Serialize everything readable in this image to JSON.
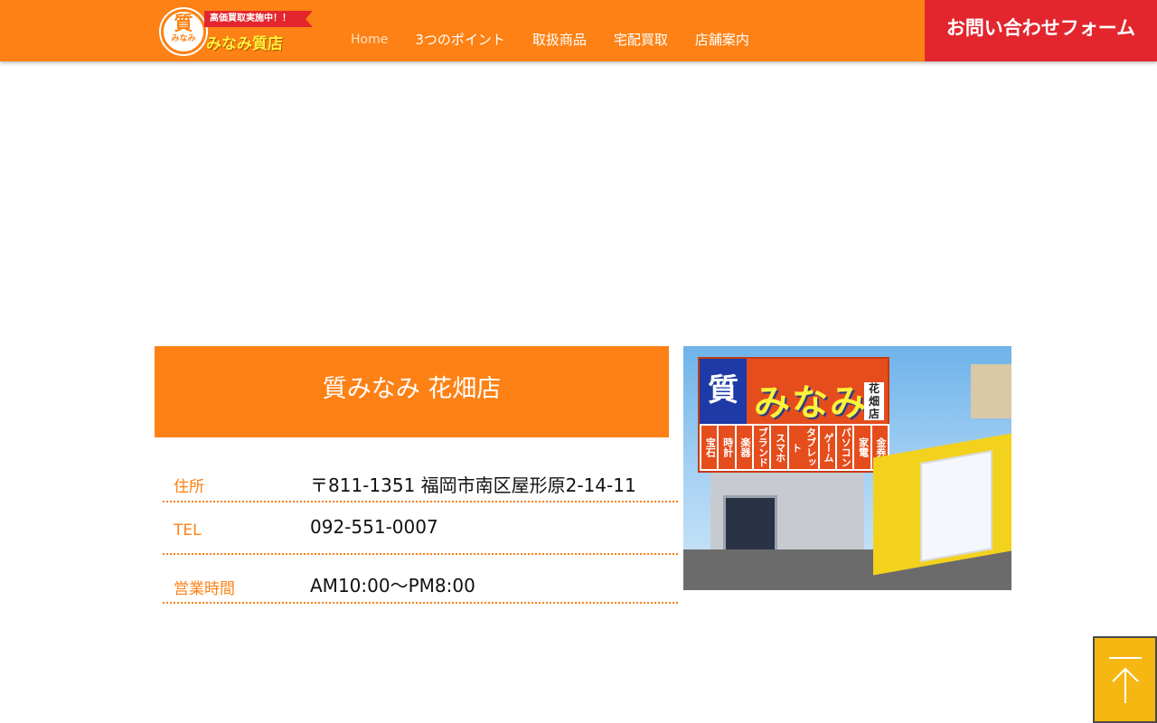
{
  "header": {
    "logo": {
      "mark_big": "質",
      "mark_small": "みなみ",
      "ribbon": "高価買取実施中！！",
      "name": "みなみ質店"
    },
    "nav": [
      {
        "label": "Home"
      },
      {
        "label": "3つのポイント"
      },
      {
        "label": "取扱商品"
      },
      {
        "label": "宅配買取"
      },
      {
        "label": "店舗案内"
      }
    ],
    "contact_button": "お問い合わせフォーム"
  },
  "store": {
    "name": "質みなみ 花畑店",
    "rows": [
      {
        "label": "住所",
        "value": "〒811-1351 福岡市南区屋形原2-14-11"
      },
      {
        "label": "TEL",
        "value": "092-551-0007"
      },
      {
        "label": "営業時間",
        "value": "AM10:00～PM8:00"
      }
    ],
    "photo": {
      "sign_blue": "質",
      "sign_main": "みなみ",
      "sign_branch": "花畑店",
      "categories": [
        "宝石",
        "時計",
        "楽器",
        "ブランド",
        "スマホ",
        "タブレット",
        "ゲーム",
        "パソコン",
        "家電",
        "金券"
      ]
    }
  },
  "back_to_top": {
    "icon": "arrow-up-icon"
  },
  "colors": {
    "header_orange": "#fd8114",
    "contact_red": "#e3262e",
    "back_to_top_yellow": "#f6b713"
  }
}
